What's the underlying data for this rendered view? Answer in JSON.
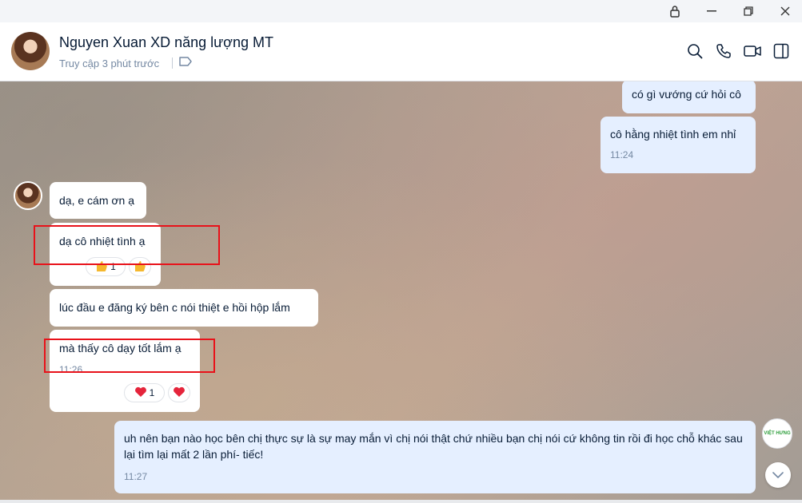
{
  "contact": {
    "name": "Nguyen Xuan XD năng lượng MT",
    "status": "Truy cập 3 phút trước"
  },
  "messages": {
    "out1": {
      "text": "có gì vướng cứ hỏi cô"
    },
    "out2": {
      "text": "cô hằng nhiệt tình em nhỉ",
      "time": "11:24"
    },
    "in1": {
      "text": "dạ, e cám ơn ạ"
    },
    "in2": {
      "text": "dạ cô nhiệt tình ạ",
      "reaction_count": "1"
    },
    "in3": {
      "text": "lúc đầu e đăng ký bên c nói thiệt e hồi hộp lắm"
    },
    "in4": {
      "text": "mà thấy cô dạy tốt lắm ạ",
      "time": "11:26",
      "reaction_count": "1"
    },
    "out3": {
      "text": "uh nên  bạn nào học bên chị thực sự là sự may mắn vì chị nói thật chứ nhiều bạn chị nói cứ không tin rồi đi học chỗ khác sau lại tìm lại mất 2 lần phí- tiếc!",
      "time": "11:27"
    }
  },
  "side_logo_text": "VIỆT HƯNG",
  "icons": [
    "lock-icon",
    "minimize-icon",
    "restore-icon",
    "close-icon",
    "search-icon",
    "phone-icon",
    "video-icon",
    "sidebar-toggle-icon",
    "tag-icon",
    "thumbs-up-icon",
    "heart-icon",
    "chevron-down-icon"
  ],
  "colors": {
    "highlight": "#e8121a",
    "out_bubble": "#e5efff",
    "in_bubble": "#ffffff"
  }
}
